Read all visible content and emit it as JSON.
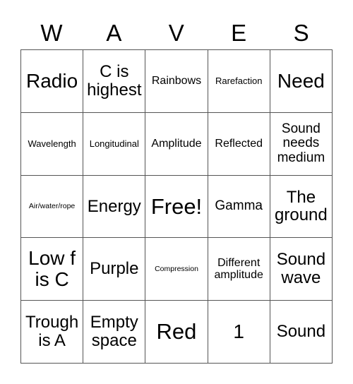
{
  "card": {
    "title": "WAVES",
    "header_letters": [
      "W",
      "A",
      "V",
      "E",
      "S"
    ],
    "grid_size": "5x5",
    "free_space_label": "Free!",
    "colors": {
      "background": "#ffffff",
      "text": "#000000",
      "border": "#555555"
    },
    "cells": [
      [
        {
          "text": "Radio",
          "size": "xxl"
        },
        {
          "text": "C is highest",
          "size": "xl"
        },
        {
          "text": "Rainbows",
          "size": "md"
        },
        {
          "text": "Rarefaction",
          "size": "sm"
        },
        {
          "text": "Need",
          "size": "xxl"
        }
      ],
      [
        {
          "text": "Wavelength",
          "size": "sm"
        },
        {
          "text": "Longitudinal",
          "size": "sm"
        },
        {
          "text": "Amplitude",
          "size": "md"
        },
        {
          "text": "Reflected",
          "size": "md"
        },
        {
          "text": "Sound needs medium",
          "size": "lg"
        }
      ],
      [
        {
          "text": "Air/water/rope",
          "size": "xs"
        },
        {
          "text": "Energy",
          "size": "xl"
        },
        {
          "text": "Free!",
          "size": "huge"
        },
        {
          "text": "Gamma",
          "size": "lg"
        },
        {
          "text": "The ground",
          "size": "xl"
        }
      ],
      [
        {
          "text": "Low f is C",
          "size": "xxl"
        },
        {
          "text": "Purple",
          "size": "xl"
        },
        {
          "text": "Compression",
          "size": "xs"
        },
        {
          "text": "Different amplitude",
          "size": "md"
        },
        {
          "text": "Sound wave",
          "size": "xl"
        }
      ],
      [
        {
          "text": "Trough is A",
          "size": "xl"
        },
        {
          "text": "Empty space",
          "size": "xl"
        },
        {
          "text": "Red",
          "size": "huge"
        },
        {
          "text": "1",
          "size": "xxl"
        },
        {
          "text": "Sound",
          "size": "xl"
        }
      ]
    ]
  }
}
